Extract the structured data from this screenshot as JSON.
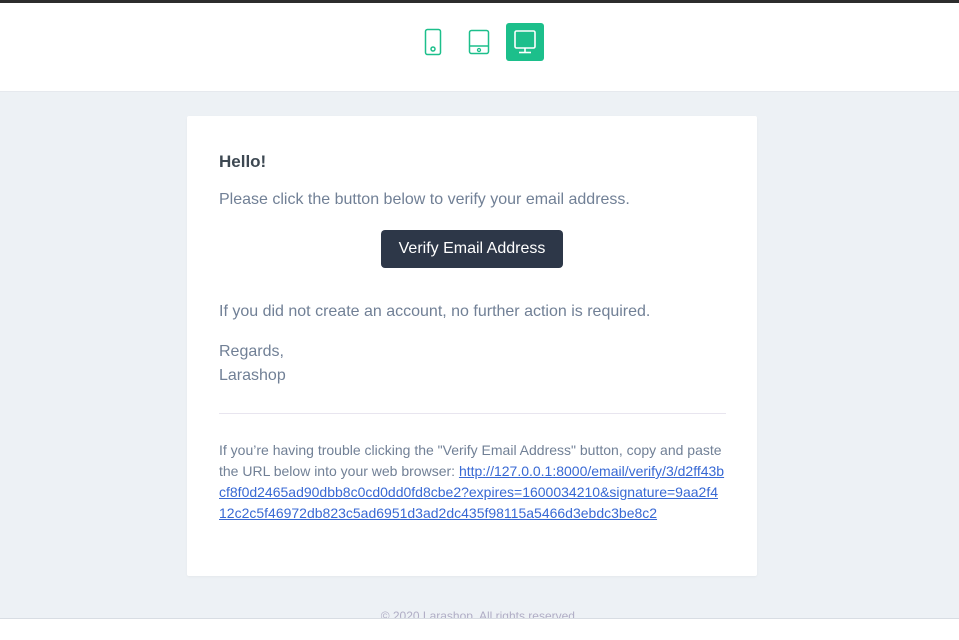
{
  "devices": [
    {
      "icon": "phone-icon",
      "active": false
    },
    {
      "icon": "tablet-icon",
      "active": false
    },
    {
      "icon": "desktop-icon",
      "active": true
    }
  ],
  "colors": {
    "accent": "#1cbf8b",
    "button_bg": "#2d3748",
    "link": "#3869d4",
    "page_bg": "#edf1f5"
  },
  "email": {
    "greeting": "Hello!",
    "intro": "Please click the button below to verify your email address.",
    "button_label": "Verify Email Address",
    "outro": "If you did not create an account, no further action is required.",
    "regards": "Regards,",
    "signature": "Larashop",
    "subcopy_text": "If you’re having trouble clicking the \"Verify Email Address\" button, copy and paste the URL below into your web browser: ",
    "verify_url": "http://127.0.0.1:8000/email/verify/3/d2ff43bcf8f0d2465ad90dbb8c0cd0dd0fd8cbe2?expires=1600034210&signature=9aa2f412c2c5f46972db823c5ad6951d3ad2dc435f98115a5466d3ebdc3be8c2"
  },
  "footer": {
    "copyright": "© 2020 Larashop. All rights reserved."
  }
}
